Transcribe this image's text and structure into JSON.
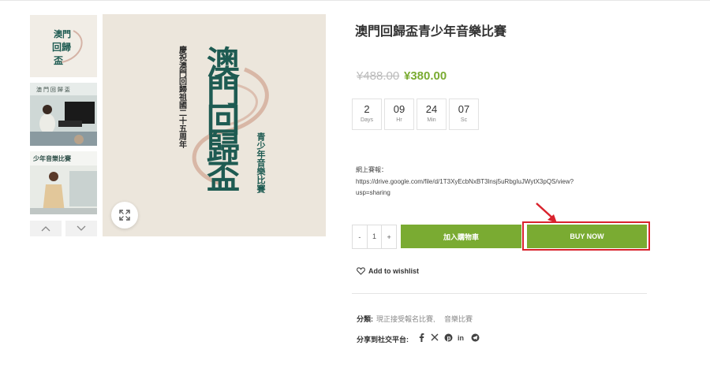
{
  "product": {
    "title": "澳門回歸盃青少年音樂比賽",
    "price_old": "¥488.00",
    "price_new": "¥380.00"
  },
  "poster": {
    "main_chars": "澳門回歸盃",
    "side_text": "慶祝澳門回歸祖國二十五周年",
    "sub_text": "青少年音樂比賽"
  },
  "thumb_banners": {
    "t2": "澳 門 回 歸 盃",
    "t3": "少年音樂比賽"
  },
  "countdown": [
    {
      "num": "2",
      "unit": "Days"
    },
    {
      "num": "09",
      "unit": "Hr"
    },
    {
      "num": "24",
      "unit": "Min"
    },
    {
      "num": "07",
      "unit": "Sc"
    }
  ],
  "description": {
    "line1": "網上賽報：",
    "line2": "https://drive.google.com/file/d/1T3XyEcbNxBT3lnsj5uRbgIuJWytX3pQS/view?",
    "line3": "usp=sharing"
  },
  "cart": {
    "qty_minus": "-",
    "qty_value": "1",
    "qty_plus": "+",
    "add_to_cart": "加入購物車",
    "buy_now": "BUY NOW"
  },
  "wishlist": "Add to wishlist",
  "meta": {
    "category_label": "分類:",
    "category_1": "現正接受報名比賽,",
    "category_2": "音樂比賽",
    "share_label": "分享到社交平台:"
  },
  "social_icons": [
    "facebook-icon",
    "x-icon",
    "pinterest-icon",
    "linkedin-icon",
    "telegram-icon"
  ],
  "colors": {
    "accent_green": "#7aab32",
    "highlight_red": "#d9232d",
    "poster_green": "#1e5b52"
  }
}
